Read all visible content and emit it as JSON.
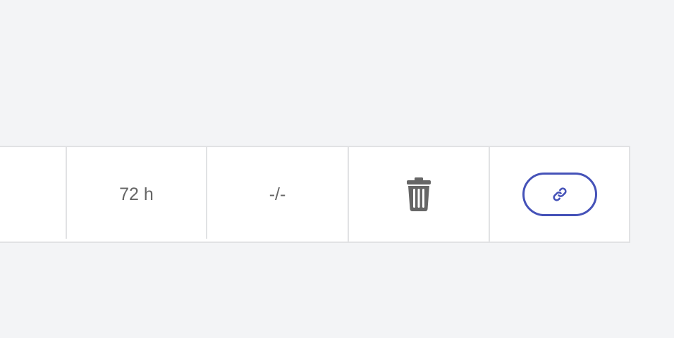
{
  "row": {
    "duration": "72 h",
    "value": "-/-",
    "delete_icon": "trash-icon",
    "link_icon": "link-icon"
  },
  "colors": {
    "page_background": "#f3f4f6",
    "row_background": "#ffffff",
    "border": "#e1e2e4",
    "text": "#666666",
    "trash_icon": "#666666",
    "link_accent": "#4552b8"
  }
}
